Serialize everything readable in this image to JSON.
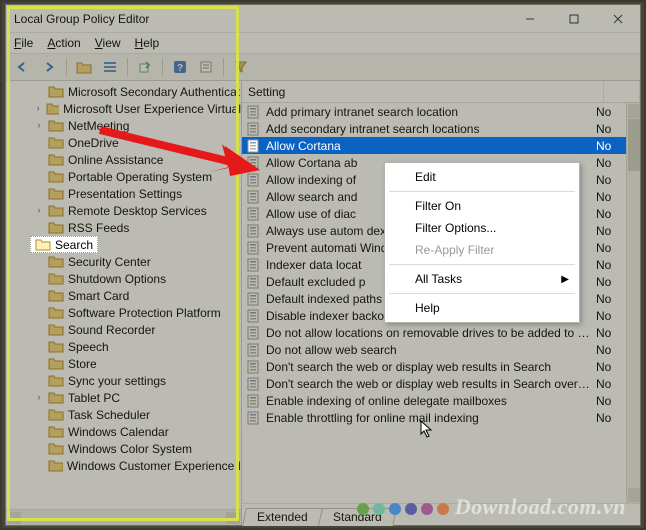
{
  "window": {
    "title": "Local Group Policy Editor"
  },
  "menu": {
    "file": "File",
    "action": "Action",
    "view": "View",
    "help": "Help"
  },
  "tree": {
    "items": [
      {
        "label": "Microsoft Secondary Authenticat",
        "expander": ""
      },
      {
        "label": "Microsoft User Experience Virtual",
        "expander": "›"
      },
      {
        "label": "NetMeeting",
        "expander": "›"
      },
      {
        "label": "OneDrive",
        "expander": ""
      },
      {
        "label": "Online Assistance",
        "expander": ""
      },
      {
        "label": "Portable Operating System",
        "expander": ""
      },
      {
        "label": "Presentation Settings",
        "expander": ""
      },
      {
        "label": "Remote Desktop Services",
        "expander": "›"
      },
      {
        "label": "RSS Feeds",
        "expander": ""
      },
      {
        "label": "Search",
        "expander": "",
        "selected": true
      },
      {
        "label": "Security Center",
        "expander": ""
      },
      {
        "label": "Shutdown Options",
        "expander": ""
      },
      {
        "label": "Smart Card",
        "expander": ""
      },
      {
        "label": "Software Protection Platform",
        "expander": ""
      },
      {
        "label": "Sound Recorder",
        "expander": ""
      },
      {
        "label": "Speech",
        "expander": ""
      },
      {
        "label": "Store",
        "expander": ""
      },
      {
        "label": "Sync your settings",
        "expander": ""
      },
      {
        "label": "Tablet PC",
        "expander": "›"
      },
      {
        "label": "Task Scheduler",
        "expander": ""
      },
      {
        "label": "Windows Calendar",
        "expander": ""
      },
      {
        "label": "Windows Color System",
        "expander": ""
      },
      {
        "label": "Windows Customer Experience I",
        "expander": ""
      }
    ]
  },
  "list": {
    "header": {
      "setting": "Setting",
      "state": ""
    },
    "rows": [
      {
        "text": "Add primary intranet search location",
        "state": "No"
      },
      {
        "text": "Add secondary intranet search locations",
        "state": "No"
      },
      {
        "text": "Allow Cortana",
        "state": "No",
        "selected": true
      },
      {
        "text": "Allow Cortana ab",
        "state": "No"
      },
      {
        "text": "Allow indexing of",
        "state": "No"
      },
      {
        "text": "Allow search and",
        "state": "No"
      },
      {
        "text": "Allow use of diac",
        "state": "No"
      },
      {
        "text": "Always use autom                                   dexing co...",
        "state": "No"
      },
      {
        "text": "Prevent automati                                    Window...",
        "state": "No"
      },
      {
        "text": "Indexer data locat",
        "state": "No"
      },
      {
        "text": "Default excluded p",
        "state": "No"
      },
      {
        "text": "Default indexed paths",
        "state": "No"
      },
      {
        "text": "Disable indexer backoff",
        "state": "No"
      },
      {
        "text": "Do not allow locations on removable drives to be added to li...",
        "state": "No"
      },
      {
        "text": "Do not allow web search",
        "state": "No"
      },
      {
        "text": "Don't search the web or display web results in Search",
        "state": "No"
      },
      {
        "text": "Don't search the web or display web results in Search over ...",
        "state": "No"
      },
      {
        "text": "Enable indexing of online delegate mailboxes",
        "state": "No"
      },
      {
        "text": "Enable throttling for online mail indexing",
        "state": "No"
      }
    ]
  },
  "context_menu": {
    "items": [
      {
        "label": "Edit",
        "type": "item"
      },
      {
        "type": "sep"
      },
      {
        "label": "Filter On",
        "type": "item"
      },
      {
        "label": "Filter Options...",
        "type": "item"
      },
      {
        "label": "Re-Apply Filter",
        "type": "item",
        "disabled": true
      },
      {
        "type": "sep"
      },
      {
        "label": "All Tasks",
        "type": "item",
        "submenu": true
      },
      {
        "type": "sep"
      },
      {
        "label": "Help",
        "type": "item"
      }
    ]
  },
  "tabs": {
    "extended": "Extended",
    "standard": "Standard"
  },
  "watermark": {
    "text": "Download.com.vn"
  },
  "colors": {
    "selection": "#0a63c2",
    "highlight_border": "#d8e04c",
    "arrow": "#e51919",
    "dots": [
      "#6a9f4b",
      "#6fb79e",
      "#4a86c7",
      "#5a5da1",
      "#a15a8e",
      "#c97a4a"
    ]
  }
}
